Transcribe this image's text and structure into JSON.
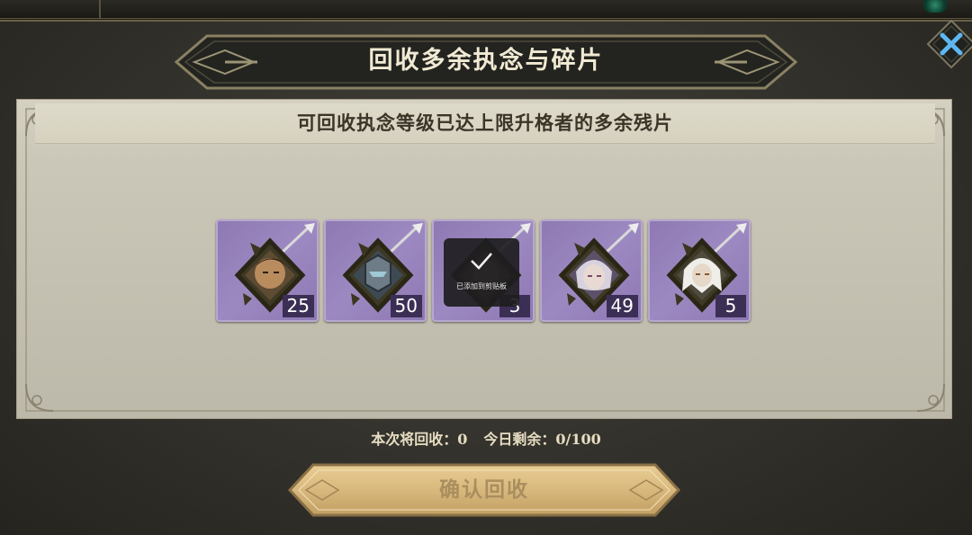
{
  "dialog": {
    "title": "回收多余执念与碎片",
    "subtitle": "可回收执念等级已达上限升格者的多余残片",
    "close_icon": "close-icon"
  },
  "items": [
    {
      "quantity": "25",
      "portrait_icon": "portrait-dark-haired-warrior-icon"
    },
    {
      "quantity": "50",
      "portrait_icon": "portrait-armored-knight-icon"
    },
    {
      "quantity": "3",
      "portrait_icon": "portrait-hidden-icon"
    },
    {
      "quantity": "49",
      "portrait_icon": "portrait-silver-haired-icon"
    },
    {
      "quantity": "5",
      "portrait_icon": "portrait-white-haired-icon"
    }
  ],
  "toast": {
    "text": "已添加到剪贴板",
    "icon": "check-icon"
  },
  "summary": {
    "recycle_label": "本次将回收：",
    "recycle_value": "0",
    "remaining_label": "今日剩余：",
    "remaining_value": "0/100"
  },
  "confirm_button": {
    "label": "确认回收"
  },
  "colors": {
    "item_purple": "#9d89c1",
    "quantity_bg": "#3c2f55",
    "title_banner": "#23241f",
    "close_blue": "#5fb6f0",
    "confirm_gold": "#d8b87d"
  }
}
